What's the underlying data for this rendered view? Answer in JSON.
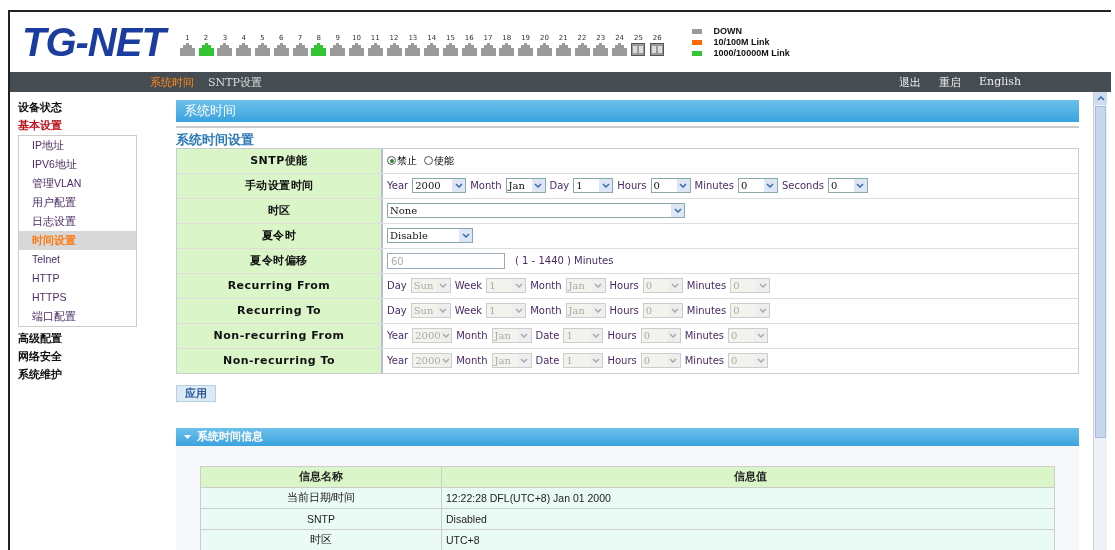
{
  "header": {
    "logo": "TG-NET",
    "ports": [
      {
        "number": "1",
        "color": "#9a9a9a",
        "kind": "rj45"
      },
      {
        "number": "2",
        "color": "#33c433",
        "kind": "rj45"
      },
      {
        "number": "3",
        "color": "#9a9a9a",
        "kind": "rj45"
      },
      {
        "number": "4",
        "color": "#9a9a9a",
        "kind": "rj45"
      },
      {
        "number": "5",
        "color": "#9a9a9a",
        "kind": "rj45"
      },
      {
        "number": "6",
        "color": "#9a9a9a",
        "kind": "rj45"
      },
      {
        "number": "7",
        "color": "#9a9a9a",
        "kind": "rj45"
      },
      {
        "number": "8",
        "color": "#33c433",
        "kind": "rj45"
      },
      {
        "number": "9",
        "color": "#9a9a9a",
        "kind": "rj45"
      },
      {
        "number": "10",
        "color": "#9a9a9a",
        "kind": "rj45"
      },
      {
        "number": "11",
        "color": "#9a9a9a",
        "kind": "rj45"
      },
      {
        "number": "12",
        "color": "#9a9a9a",
        "kind": "rj45"
      },
      {
        "number": "13",
        "color": "#9a9a9a",
        "kind": "rj45"
      },
      {
        "number": "14",
        "color": "#9a9a9a",
        "kind": "rj45"
      },
      {
        "number": "15",
        "color": "#9a9a9a",
        "kind": "rj45"
      },
      {
        "number": "16",
        "color": "#9a9a9a",
        "kind": "rj45"
      },
      {
        "number": "17",
        "color": "#9a9a9a",
        "kind": "rj45"
      },
      {
        "number": "18",
        "color": "#9a9a9a",
        "kind": "rj45"
      },
      {
        "number": "19",
        "color": "#9a9a9a",
        "kind": "rj45"
      },
      {
        "number": "20",
        "color": "#9a9a9a",
        "kind": "rj45"
      },
      {
        "number": "21",
        "color": "#9a9a9a",
        "kind": "rj45"
      },
      {
        "number": "22",
        "color": "#9a9a9a",
        "kind": "rj45"
      },
      {
        "number": "23",
        "color": "#9a9a9a",
        "kind": "rj45"
      },
      {
        "number": "24",
        "color": "#9a9a9a",
        "kind": "rj45"
      },
      {
        "number": "25",
        "color": "#9a9a9a",
        "kind": "sfp"
      },
      {
        "number": "26",
        "color": "#9a9a9a",
        "kind": "sfp"
      }
    ],
    "legend": [
      {
        "label": "DOWN",
        "color": "#9a9a9a"
      },
      {
        "label": "10/100M Link",
        "color": "#ff6600"
      },
      {
        "label": "1000/10000M Link",
        "color": "#33c433"
      }
    ]
  },
  "nav": {
    "tabs": [
      {
        "label": "系统时间",
        "selected": true
      },
      {
        "label": "SNTP设置",
        "selected": false
      }
    ],
    "actions": [
      "退出",
      "重启",
      "English"
    ]
  },
  "sidebar": {
    "items": [
      {
        "label": "设备状态",
        "selected": false
      },
      {
        "label": "基本设置",
        "selected": true,
        "children": [
          {
            "label": "IP地址",
            "selected": false
          },
          {
            "label": "IPV6地址",
            "selected": false
          },
          {
            "label": "管理VLAN",
            "selected": false
          },
          {
            "label": "用户配置",
            "selected": false
          },
          {
            "label": "日志设置",
            "selected": false
          },
          {
            "label": "时间设置",
            "selected": true
          },
          {
            "label": "Telnet",
            "selected": false
          },
          {
            "label": "HTTP",
            "selected": false
          },
          {
            "label": "HTTPS",
            "selected": false
          },
          {
            "label": "端口配置",
            "selected": false
          }
        ]
      },
      {
        "label": "高级配置",
        "selected": false
      },
      {
        "label": "网络安全",
        "selected": false
      },
      {
        "label": "系统维护",
        "selected": false
      }
    ]
  },
  "page_title": "系统时间",
  "form": {
    "title": "系统时间设置",
    "rows": [
      {
        "label": "SNTP使能",
        "kind": "radio",
        "options": [
          {
            "label": "禁止",
            "selected": true
          },
          {
            "label": "使能",
            "selected": false
          }
        ]
      },
      {
        "label": "手动设置时间",
        "kind": "fields",
        "fields": [
          {
            "label": "Year",
            "value": "2000",
            "disabled": false
          },
          {
            "label": "Month",
            "value": "Jan",
            "disabled": false
          },
          {
            "label": "Day",
            "value": "1",
            "disabled": false
          },
          {
            "label": "Hours",
            "value": "0",
            "disabled": false
          },
          {
            "label": "Minutes",
            "value": "0",
            "disabled": false
          },
          {
            "label": "Seconds",
            "value": "0",
            "disabled": false
          }
        ]
      },
      {
        "label": "时区",
        "kind": "wide-select",
        "value": "None",
        "disabled": false
      },
      {
        "label": "夏令时",
        "kind": "select",
        "value": "Disable",
        "disabled": false
      },
      {
        "label": "夏令时偏移",
        "kind": "input",
        "value": "60",
        "disabled": true,
        "unit": "( 1 - 1440 ) Minutes"
      },
      {
        "label": "Recurring From",
        "kind": "fields",
        "fields": [
          {
            "label": "Day",
            "value": "Sun",
            "disabled": true
          },
          {
            "label": "Week",
            "value": "1",
            "disabled": true
          },
          {
            "label": "Month",
            "value": "Jan",
            "disabled": true
          },
          {
            "label": "Hours",
            "value": "0",
            "disabled": true
          },
          {
            "label": "Minutes",
            "value": "0",
            "disabled": true
          }
        ]
      },
      {
        "label": "Recurring To",
        "kind": "fields",
        "fields": [
          {
            "label": "Day",
            "value": "Sun",
            "disabled": true
          },
          {
            "label": "Week",
            "value": "1",
            "disabled": true
          },
          {
            "label": "Month",
            "value": "Jan",
            "disabled": true
          },
          {
            "label": "Hours",
            "value": "0",
            "disabled": true
          },
          {
            "label": "Minutes",
            "value": "0",
            "disabled": true
          }
        ]
      },
      {
        "label": "Non-recurring From",
        "kind": "fields",
        "fields": [
          {
            "label": "Year",
            "value": "2000",
            "disabled": true
          },
          {
            "label": "Month",
            "value": "Jan",
            "disabled": true
          },
          {
            "label": "Date",
            "value": "1",
            "disabled": true
          },
          {
            "label": "Hours",
            "value": "0",
            "disabled": true
          },
          {
            "label": "Minutes",
            "value": "0",
            "disabled": true
          }
        ]
      },
      {
        "label": "Non-recurring To",
        "kind": "fields",
        "fields": [
          {
            "label": "Year",
            "value": "2000",
            "disabled": true
          },
          {
            "label": "Month",
            "value": "Jan",
            "disabled": true
          },
          {
            "label": "Date",
            "value": "1",
            "disabled": true
          },
          {
            "label": "Hours",
            "value": "0",
            "disabled": true
          },
          {
            "label": "Minutes",
            "value": "0",
            "disabled": true
          }
        ]
      }
    ],
    "apply_button": "应用"
  },
  "info": {
    "title": "系统时间信息",
    "expanded": true,
    "columns": [
      "信息名称",
      "信息值"
    ],
    "rows": [
      {
        "name": "当前日期/时间",
        "value": "12:22:28 DFL(UTC+8) Jan 01 2000"
      },
      {
        "name": "SNTP",
        "value": "Disabled"
      },
      {
        "name": "时区",
        "value": "UTC+8"
      }
    ]
  }
}
